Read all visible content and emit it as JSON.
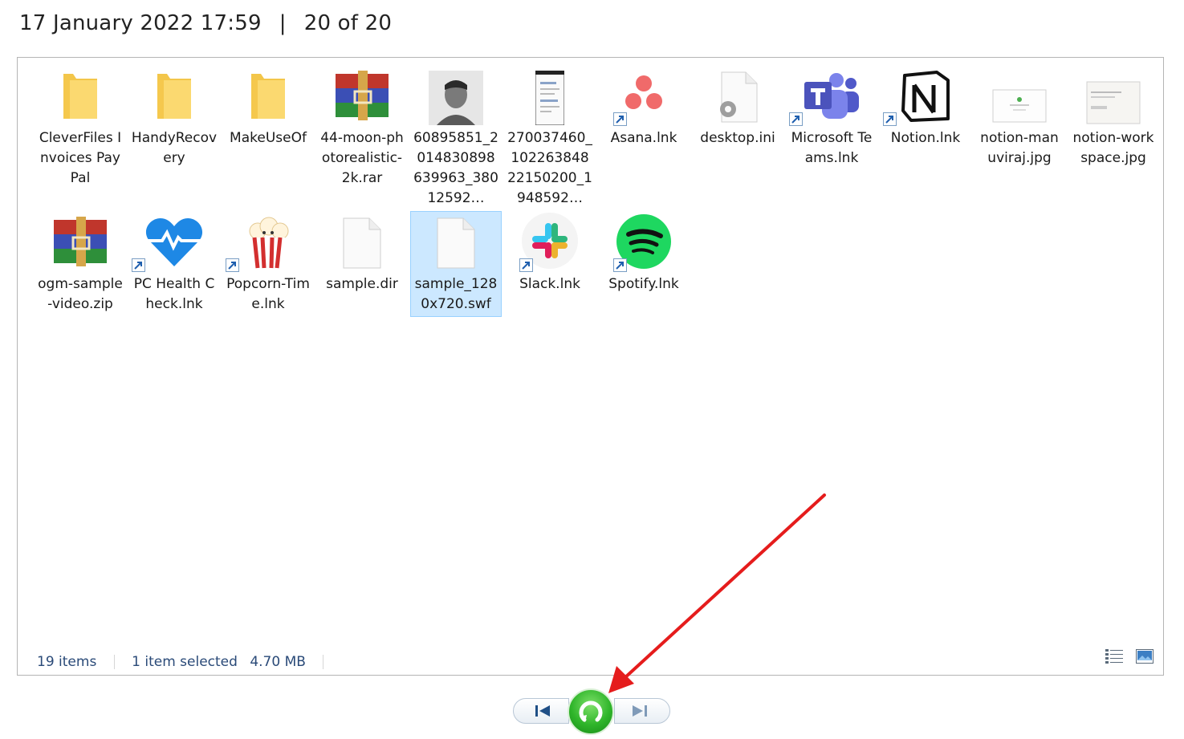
{
  "header": {
    "datetime": "17 January 2022 17:59",
    "separator": "|",
    "counter": "20 of 20"
  },
  "files": [
    {
      "label": "CleverFiles Invoices PayPal",
      "icon": "folder-icon",
      "shortcut": false
    },
    {
      "label": "HandyRecovery",
      "icon": "folder-icon",
      "shortcut": false
    },
    {
      "label": "MakeUseOf",
      "icon": "folder-icon",
      "shortcut": false
    },
    {
      "label": "44-moon-photorealistic-2k.rar",
      "icon": "winrar-archive-icon",
      "shortcut": false
    },
    {
      "label": "60895851_2014830898639963_38012592…",
      "icon": "photo-thumbnail-icon",
      "shortcut": false
    },
    {
      "label": "270037460_10226384822150200_1948592…",
      "icon": "screenshot-thumbnail-icon",
      "shortcut": false
    },
    {
      "label": "Asana.lnk",
      "icon": "asana-icon",
      "shortcut": true
    },
    {
      "label": "desktop.ini",
      "icon": "settings-file-icon",
      "shortcut": false
    },
    {
      "label": "Microsoft Teams.lnk",
      "icon": "teams-icon",
      "shortcut": true
    },
    {
      "label": "Notion.lnk",
      "icon": "notion-icon",
      "shortcut": true
    },
    {
      "label": "notion-manuviraj.jpg",
      "icon": "image-thumbnail-icon",
      "shortcut": false
    },
    {
      "label": "notion-workspace.jpg",
      "icon": "image-thumbnail-icon",
      "shortcut": false
    },
    {
      "label": "ogm-sample-video.zip",
      "icon": "winrar-archive-icon",
      "shortcut": false
    },
    {
      "label": "PC Health Check.lnk",
      "icon": "pc-health-icon",
      "shortcut": true
    },
    {
      "label": "Popcorn-Time.lnk",
      "icon": "popcorn-icon",
      "shortcut": true
    },
    {
      "label": "sample.dir",
      "icon": "blank-file-icon",
      "shortcut": false
    },
    {
      "label": "sample_1280x720.swf",
      "icon": "blank-file-icon",
      "shortcut": false,
      "selected": true
    },
    {
      "label": "Slack.lnk",
      "icon": "slack-icon",
      "shortcut": true
    },
    {
      "label": "Spotify.lnk",
      "icon": "spotify-icon",
      "shortcut": true
    }
  ],
  "status": {
    "item_count": "19 items",
    "selection": "1 item selected",
    "size": "4.70 MB"
  },
  "player": {
    "prev": "previous-icon",
    "restore": "restore-icon",
    "next": "next-icon"
  },
  "colors": {
    "selection": "#cce8ff",
    "status_text": "#2a4a78",
    "arrow": "#e51c1c",
    "play": "#2fb52a"
  }
}
